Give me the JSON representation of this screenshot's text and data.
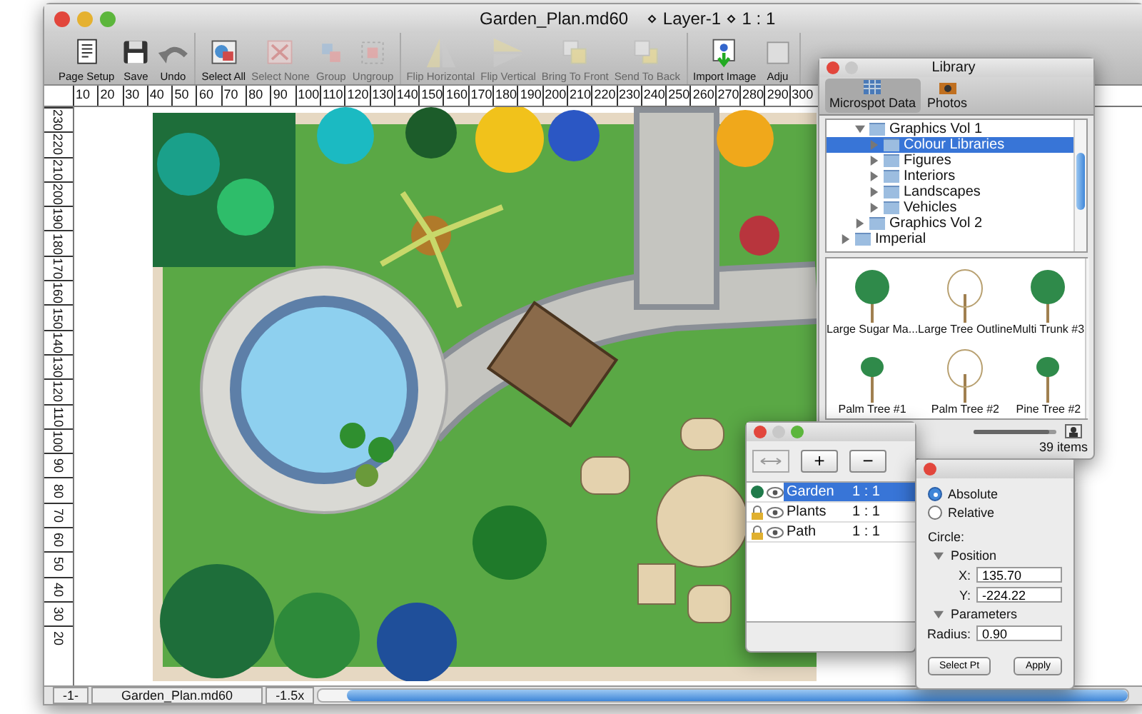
{
  "main_window": {
    "title": "Garden_Plan.md60",
    "title_info": "⋄ Layer-1 ⋄ 1 : 1"
  },
  "toolbar": {
    "groups": [
      [
        {
          "label": "Page Setup",
          "disabled": false
        },
        {
          "label": "Save",
          "disabled": false
        },
        {
          "label": "Undo",
          "disabled": false
        }
      ],
      [
        {
          "label": "Select All",
          "disabled": false
        },
        {
          "label": "Select None",
          "disabled": true
        },
        {
          "label": "Group",
          "disabled": true
        },
        {
          "label": "Ungroup",
          "disabled": true
        }
      ],
      [
        {
          "label": "Flip Horizontal",
          "disabled": true
        },
        {
          "label": "Flip Vertical",
          "disabled": true
        },
        {
          "label": "Bring To Front",
          "disabled": true
        },
        {
          "label": "Send To Back",
          "disabled": true
        }
      ],
      [
        {
          "label": "Import Image",
          "disabled": false
        },
        {
          "label": "Adju",
          "disabled": false
        }
      ]
    ]
  },
  "horizontal_ruler": [
    "10",
    "20",
    "30",
    "40",
    "50",
    "60",
    "70",
    "80",
    "90",
    "100",
    "110",
    "120",
    "130",
    "140",
    "150",
    "160",
    "170",
    "180",
    "190",
    "200",
    "210",
    "220",
    "230",
    "240",
    "250",
    "260",
    "270",
    "280",
    "290",
    "300"
  ],
  "vertical_ruler": [
    "230",
    "220",
    "210",
    "200",
    "190",
    "180",
    "170",
    "160",
    "150",
    "140",
    "130",
    "120",
    "110",
    "100",
    "90",
    "80",
    "70",
    "60",
    "50",
    "40",
    "30",
    "20"
  ],
  "status_bar": {
    "page": "-1-",
    "file": "Garden_Plan.md60",
    "zoom": "-1.5x"
  },
  "library": {
    "title": "Library",
    "tabs": [
      {
        "label": "Microspot Data",
        "selected": true
      },
      {
        "label": "Photos",
        "selected": false
      }
    ],
    "tree": [
      {
        "children": [
          {
            "label": "Graphics Vol 1",
            "expanded": true,
            "selected": false,
            "children": [
              {
                "label": "Colour Libraries",
                "expanded": false,
                "selected": true
              },
              {
                "label": "Figures",
                "expanded": false,
                "selected": false
              },
              {
                "label": "Interiors",
                "expanded": false,
                "selected": false
              },
              {
                "label": "Landscapes",
                "expanded": false,
                "selected": false
              },
              {
                "label": "Vehicles",
                "expanded": false,
                "selected": false
              }
            ]
          },
          {
            "label": "Graphics Vol 2",
            "expanded": false,
            "selected": false
          }
        ]
      },
      {
        "label": "Imperial",
        "expanded": false,
        "selected": false
      }
    ],
    "items": [
      {
        "label": "Large Sugar Ma..."
      },
      {
        "label": "Large Tree Outline"
      },
      {
        "label": "Multi Trunk #3"
      },
      {
        "label": "Palm Tree #1"
      },
      {
        "label": "Palm Tree #2"
      },
      {
        "label": "Pine Tree #2"
      }
    ],
    "size_slider": {
      "level": 0.92
    },
    "count": "39 items"
  },
  "layers": {
    "buttons": [
      "+",
      "−"
    ],
    "rows": [
      {
        "name": "Garden",
        "scale": "1 : 1",
        "locked": false,
        "selected": true
      },
      {
        "name": "Plants",
        "scale": "1 : 1",
        "locked": true,
        "selected": false
      },
      {
        "name": "Path",
        "scale": "1 : 1",
        "locked": true,
        "selected": false
      }
    ]
  },
  "inspector": {
    "modes": [
      {
        "label": "Absolute",
        "selected": true
      },
      {
        "label": "Relative",
        "selected": false
      }
    ],
    "shape": "Circle:",
    "sections": [
      {
        "title": "Position",
        "expanded": true,
        "fields": [
          {
            "label": "X:",
            "value": "135.70"
          },
          {
            "label": "Y:",
            "value": "-224.22"
          }
        ]
      },
      {
        "title": "Parameters",
        "expanded": true,
        "fields": [
          {
            "label": "Radius:",
            "value": "0.90"
          }
        ]
      }
    ],
    "buttons": [
      "Select Pt",
      "Apply"
    ]
  }
}
